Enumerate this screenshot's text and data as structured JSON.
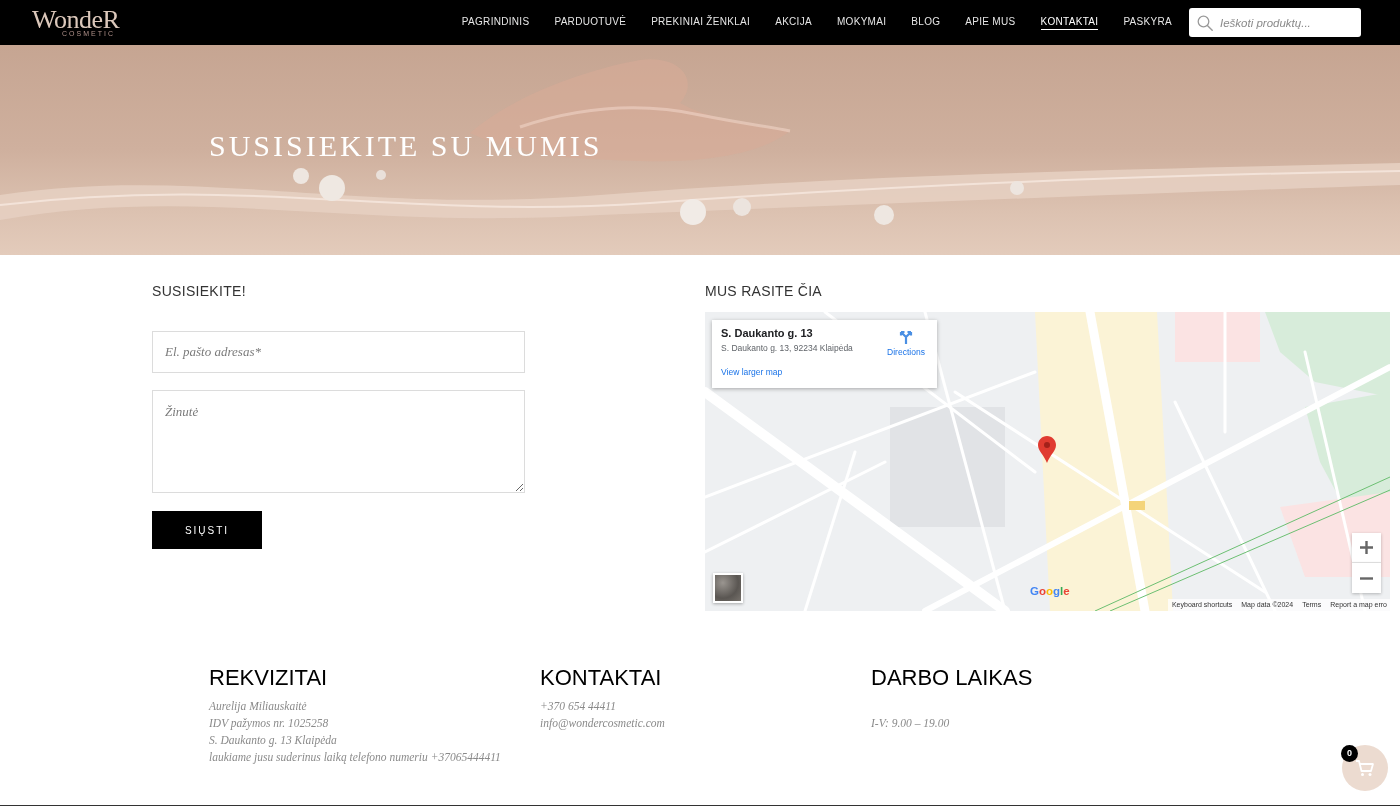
{
  "header": {
    "logo": {
      "wordmark": "WondeR",
      "tagline": "COSMETIC"
    },
    "nav": [
      {
        "label": "PAGRINDINIS",
        "selected": false
      },
      {
        "label": "PARDUOTUVĖ",
        "selected": false
      },
      {
        "label": "PREKINIAI ŽENKLAI",
        "selected": false
      },
      {
        "label": "AKCIJA",
        "selected": false
      },
      {
        "label": "MOKYMAI",
        "selected": false
      },
      {
        "label": "BLOG",
        "selected": false
      },
      {
        "label": "APIE MUS",
        "selected": false
      },
      {
        "label": "KONTAKTAI",
        "selected": true
      },
      {
        "label": "PASKYRA",
        "selected": false
      }
    ],
    "search": {
      "placeholder": "Ieškoti produktų..."
    }
  },
  "hero": {
    "title": "SUSISIEKITE SU MUMIS"
  },
  "contact_form": {
    "heading": "SUSISIEKITE!",
    "fields": [
      {
        "kind": "input",
        "placeholder": "El. pašto adresas*"
      },
      {
        "kind": "textarea",
        "placeholder": "Žinutė"
      }
    ],
    "submit": "SIŲSTI"
  },
  "map_section": {
    "heading": "MUS RASITE ČIA",
    "place_card": {
      "title": "S. Daukanto g. 13",
      "address": "S. Daukanto g. 13, 92234 Klaipėda",
      "directions": "Directions",
      "larger_map": "View larger map"
    },
    "logo": "Google",
    "attribution": [
      "Keyboard shortcuts",
      "Map data ©2024",
      "Terms",
      "Report a map erro"
    ]
  },
  "footer": {
    "columns": [
      {
        "heading": "REKVIZITAI",
        "lines": [
          "Aurelija Miliauskaitė",
          "IDV pažymos nr. 1025258",
          "S. Daukanto g. 13 Klaipėda",
          "laukiame jusu suderinus laiką telefono numeriu +37065444411"
        ]
      },
      {
        "heading": "KONTAKTAI",
        "lines": [
          "+370 654 44411",
          "info@wondercosmetic.com"
        ]
      },
      {
        "heading": "DARBO LAIKAS",
        "lines": [
          "I-V: 9.00 – 19.00"
        ]
      }
    ]
  },
  "cart": {
    "count": "0"
  }
}
